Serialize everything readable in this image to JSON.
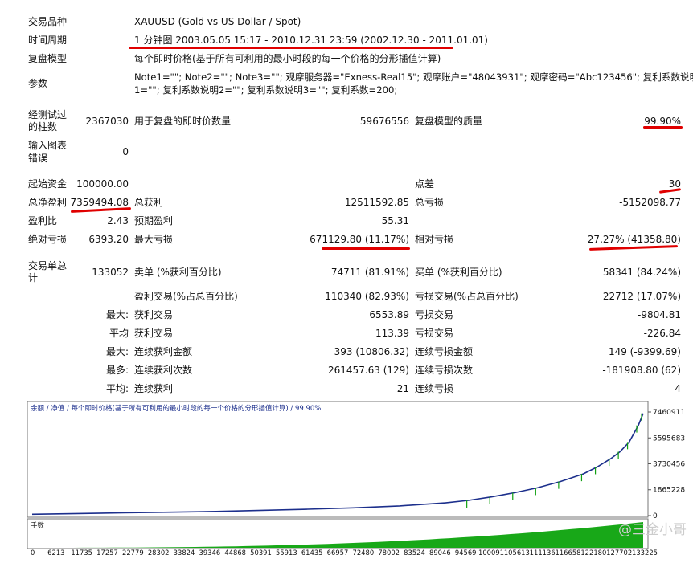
{
  "info": {
    "symbol_label": "交易品种",
    "symbol": "XAUUSD (Gold vs US Dollar / Spot)",
    "period_label": "时间周期",
    "period": "1 分钟图 2003.05.05 15:17 - 2010.12.31 23:59 (2002.12.30 - 2011.01.01)",
    "model_label": "复盘模型",
    "model": "每个即时价格(基于所有可利用的最小时段的每一个价格的分形插值计算)",
    "params_label": "参数",
    "params_line1": "Note1=\"\"; Note2=\"\"; Note3=\"\"; 观摩服务器=\"Exness-Real15\"; 观摩账户=\"48043931\"; 观摩密码=\"Abc123456\"; 复利系数说明",
    "params_line2": "1=\"\"; 复利系数说明2=\"\"; 复利系数说明3=\"\"; 复利系数=200;"
  },
  "stats": {
    "bars_label_1": "经测试过",
    "bars_label_2": "的柱数",
    "bars": "2367030",
    "ticks_label": "用于复盘的即时价数量",
    "ticks": "59676556",
    "quality_label": "复盘模型的质量",
    "quality": "99.90%",
    "errors_label_1": "输入图表",
    "errors_label_2": "错误",
    "errors": "0",
    "deposit_label": "起始资金",
    "deposit": "100000.00",
    "spread_label": "点差",
    "spread": "30",
    "net_label": "总净盈利",
    "net": "7359494.08",
    "gross_profit_label": "总获利",
    "gross_profit": "12511592.85",
    "gross_loss_label": "总亏损",
    "gross_loss": "-5152098.77",
    "pf_label": "盈利比",
    "pf": "2.43",
    "payoff_label": "预期盈利",
    "payoff": "55.31",
    "abs_dd_label": "绝对亏损",
    "abs_dd": "6393.20",
    "max_dd_label": "最大亏损",
    "max_dd": "671129.80 (11.17%)",
    "rel_dd_label": "相对亏损",
    "rel_dd": "27.27% (41358.80)",
    "trades_label_1": "交易单总",
    "trades_label_2": "计",
    "trades": "133052",
    "short_label": "卖单 (%获利百分比)",
    "short": "74711 (81.91%)",
    "long_label": "买单 (%获利百分比)",
    "long": "58341 (84.24%)",
    "profit_trades_label": "盈利交易(%占总百分比)",
    "profit_trades": "110340 (82.93%)",
    "loss_trades_label": "亏损交易(%占总百分比)",
    "loss_trades": "22712 (17.07%)",
    "largest_label": "最大:",
    "largest_profit_label": "获利交易",
    "largest_profit": "6553.89",
    "largest_loss_label": "亏损交易",
    "largest_loss": "-9804.81",
    "average_label": "平均",
    "average_profit_label": "获利交易",
    "average_profit": "113.39",
    "average_loss_label": "亏损交易",
    "average_loss": "-226.84",
    "max_label": "最大:",
    "max_cons_wins_label": "连续获利金额",
    "max_cons_wins": "393 (10806.32)",
    "max_cons_losses_label": "连续亏损金额",
    "max_cons_losses": "149 (-9399.69)",
    "maximal_label": "最多:",
    "maximal_cons_profit_label": "连续获利次数",
    "maximal_cons_profit": "261457.63 (129)",
    "maximal_cons_loss_label": "连续亏损次数",
    "maximal_cons_loss": "-181908.80 (62)",
    "avg_label": "平均:",
    "avg_cons_wins_label": "连续获利",
    "avg_cons_wins": "21",
    "avg_cons_losses_label": "连续亏损",
    "avg_cons_losses": "4"
  },
  "chart_data": {
    "type": "line",
    "title": "余额 / 净值 / 每个即时价格(基于所有可利用的最小时段的每一个价格的分形插值计算) / 99.90%",
    "legend": [
      "余额",
      "净值"
    ],
    "y_ticks": [
      "7460911",
      "5595683",
      "3730456",
      "1865228",
      "0"
    ],
    "x_ticks": [
      "0",
      "6213",
      "11735",
      "17257",
      "22779",
      "28302",
      "33824",
      "39346",
      "44868",
      "50391",
      "55913",
      "61435",
      "66957",
      "72480",
      "78002",
      "83524",
      "89046",
      "94569",
      "100091",
      "105613",
      "111136",
      "116658",
      "122180",
      "127702",
      "133225"
    ],
    "lot_label": "手数",
    "x": [
      0,
      10000,
      20000,
      30000,
      40000,
      50000,
      60000,
      70000,
      80000,
      90000,
      95000,
      100000,
      105000,
      110000,
      115000,
      120000,
      123000,
      126000,
      128000,
      130000,
      132000,
      133052
    ],
    "balance": [
      100000,
      150000,
      200000,
      250000,
      300000,
      380000,
      460000,
      560000,
      700000,
      920000,
      1100000,
      1350000,
      1650000,
      2000000,
      2450000,
      3000000,
      3500000,
      4100000,
      4600000,
      5300000,
      6500000,
      7359494
    ],
    "ylim": [
      0,
      7460911
    ],
    "colors": {
      "balance": "#1c2f8c",
      "equity": "#11a011",
      "lots": "#18a818"
    },
    "watermark": "@三金小哥"
  }
}
